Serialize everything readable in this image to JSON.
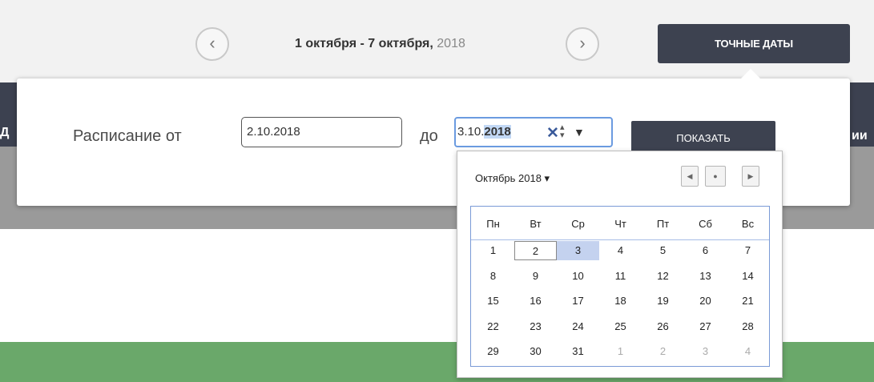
{
  "header": {
    "prev_icon": "chevron-left-icon",
    "next_icon": "chevron-right-icon",
    "range_bold": "1 октября - 7 октября,",
    "range_year": "2018",
    "exact_dates_label": "ТОЧНЫЕ ДАТЫ"
  },
  "popover": {
    "label_from": "Расписание от",
    "from_value": "2.10.2018",
    "label_to": "до",
    "to_value_plain": "3.10.",
    "to_value_selected": "2018",
    "show_label": "ПОКАЗАТЬ"
  },
  "background": {
    "left_edge_text": "Д",
    "right_edge_text": "ии"
  },
  "calendar": {
    "month_label": "Октябрь 2018 ▾",
    "weekdays": [
      "Пн",
      "Вт",
      "Ср",
      "Чт",
      "Пт",
      "Сб",
      "Вс"
    ],
    "weeks": [
      [
        {
          "d": "1",
          "o": false
        },
        {
          "d": "2",
          "o": false
        },
        {
          "d": "3",
          "o": false
        },
        {
          "d": "4",
          "o": false
        },
        {
          "d": "5",
          "o": false
        },
        {
          "d": "6",
          "o": false
        },
        {
          "d": "7",
          "o": false
        }
      ],
      [
        {
          "d": "8",
          "o": false
        },
        {
          "d": "9",
          "o": false
        },
        {
          "d": "10",
          "o": false
        },
        {
          "d": "11",
          "o": false
        },
        {
          "d": "12",
          "o": false
        },
        {
          "d": "13",
          "o": false
        },
        {
          "d": "14",
          "o": false
        }
      ],
      [
        {
          "d": "15",
          "o": false
        },
        {
          "d": "16",
          "o": false
        },
        {
          "d": "17",
          "o": false
        },
        {
          "d": "18",
          "o": false
        },
        {
          "d": "19",
          "o": false
        },
        {
          "d": "20",
          "o": false
        },
        {
          "d": "21",
          "o": false
        }
      ],
      [
        {
          "d": "22",
          "o": false
        },
        {
          "d": "23",
          "o": false
        },
        {
          "d": "24",
          "o": false
        },
        {
          "d": "25",
          "o": false
        },
        {
          "d": "26",
          "o": false
        },
        {
          "d": "27",
          "o": false
        },
        {
          "d": "28",
          "o": false
        }
      ],
      [
        {
          "d": "29",
          "o": false
        },
        {
          "d": "30",
          "o": false
        },
        {
          "d": "31",
          "o": false
        },
        {
          "d": "1",
          "o": true
        },
        {
          "d": "2",
          "o": true
        },
        {
          "d": "3",
          "o": true
        },
        {
          "d": "4",
          "o": true
        }
      ]
    ],
    "today_day": "2",
    "selected_day": "3"
  },
  "colors": {
    "dark_bar": "#3d4250",
    "accent_border": "#6b9be0",
    "selection": "#c4d2ef",
    "green_band": "#6aa86a"
  }
}
